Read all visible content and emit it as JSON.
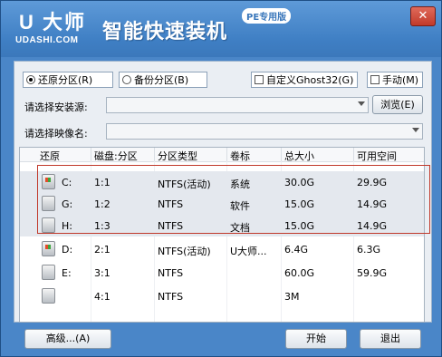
{
  "header": {
    "logo_mark": "U 大师",
    "logo_url": "UDASHI.COM",
    "title": "智能快速装机",
    "badge": "PE专用版",
    "close_label": "✕"
  },
  "options": {
    "restore_label": "还原分区(R)",
    "backup_label": "备份分区(B)",
    "custom_ghost_label": "自定义Ghost32(G)",
    "manual_label": "手动(M)",
    "restore_selected": true,
    "backup_selected": false,
    "custom_ghost_checked": false,
    "manual_checked": false
  },
  "fields": {
    "source_label": "请选择安装源:",
    "source_value": "",
    "browse_label": "浏览(E)",
    "image_label": "请选择映像名:",
    "image_value": ""
  },
  "table": {
    "columns": [
      "还原",
      "磁盘:分区",
      "分区类型",
      "卷标",
      "总大小",
      "可用空间"
    ],
    "rows": [
      {
        "drive": "C:",
        "part": "1:1",
        "type": "NTFS(活动)",
        "label": "系统",
        "total": "30.0G",
        "free": "29.9G",
        "icon": "windows-disk-icon",
        "selected": true
      },
      {
        "drive": "G:",
        "part": "1:2",
        "type": "NTFS",
        "label": "软件",
        "total": "15.0G",
        "free": "14.9G",
        "icon": "disk-icon",
        "selected": true
      },
      {
        "drive": "H:",
        "part": "1:3",
        "type": "NTFS",
        "label": "文档",
        "total": "15.0G",
        "free": "14.9G",
        "icon": "disk-icon",
        "selected": true
      },
      {
        "drive": "D:",
        "part": "2:1",
        "type": "NTFS(活动)",
        "label": "U大师...",
        "total": "6.4G",
        "free": "6.3G",
        "icon": "windows-disk-icon",
        "selected": false
      },
      {
        "drive": "E:",
        "part": "3:1",
        "type": "NTFS",
        "label": "",
        "total": "60.0G",
        "free": "59.9G",
        "icon": "disk-icon",
        "selected": false
      },
      {
        "drive": "",
        "part": "4:1",
        "type": "NTFS",
        "label": "",
        "total": "3M",
        "free": "",
        "icon": "disk-icon",
        "selected": false
      }
    ]
  },
  "footer": {
    "advanced_label": "高级...(A)",
    "start_label": "开始",
    "exit_label": "退出"
  },
  "colors": {
    "header": "#4a86c8",
    "highlight": "#c0392b"
  }
}
